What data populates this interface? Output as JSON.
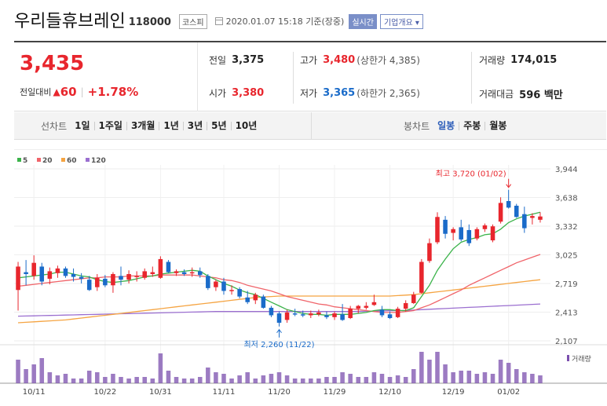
{
  "header": {
    "company": "우리들휴브레인",
    "code": "118000",
    "market": "코스피",
    "datetime": "2020.01.07 15:18 기준(장중)",
    "realtime_btn": "실시간",
    "overview_btn": "기업개요 ▾"
  },
  "quote": {
    "price": "3,435",
    "change_label": "전일대비",
    "change_arrow": "▲",
    "change_value": "60",
    "change_pct": "+1.78%",
    "prev_close": {
      "label": "전일",
      "value": "3,375"
    },
    "open": {
      "label": "시가",
      "value": "3,380"
    },
    "high": {
      "label": "고가",
      "value": "3,480",
      "sub": "(상한가 4,385)"
    },
    "low": {
      "label": "저가",
      "value": "3,365",
      "sub": "(하한가 2,365)"
    },
    "volume": {
      "label": "거래량",
      "value": "174,015"
    },
    "amount": {
      "label": "거래대금",
      "value": "596 백만"
    }
  },
  "periods": {
    "chart_label": "선차트",
    "chart_options": [
      "1일",
      "1주일",
      "3개월",
      "1년",
      "3년",
      "5년",
      "10년"
    ],
    "candle_label": "봉차트",
    "candle_options": [
      "일봉",
      "주봉",
      "월봉"
    ],
    "candle_selected": 0
  },
  "colors": {
    "up": "#e8262d",
    "down": "#1a6bc9",
    "ma5": "#3bb34a",
    "ma20": "#f0646a",
    "ma60": "#f5a442",
    "ma120": "#9b6fd0",
    "volume": "#7b4fae"
  },
  "chart_data": {
    "type": "candlestick",
    "legend": [
      "5",
      "20",
      "60",
      "120"
    ],
    "y_ticks": [
      "3,944",
      "3,638",
      "3,332",
      "3,025",
      "2,719",
      "2,413",
      "2,107"
    ],
    "ylim": [
      2107,
      3944
    ],
    "x_labels": [
      {
        "i": 2,
        "label": "10/11"
      },
      {
        "i": 11,
        "label": "10/22"
      },
      {
        "i": 18,
        "label": "10/31"
      },
      {
        "i": 26,
        "label": "11/11"
      },
      {
        "i": 33,
        "label": "11/20"
      },
      {
        "i": 40,
        "label": "11/29"
      },
      {
        "i": 47,
        "label": "12/10"
      },
      {
        "i": 55,
        "label": "12/19"
      },
      {
        "i": 62,
        "label": "01/02"
      }
    ],
    "annotations": {
      "high_label": "최고 3,720 (01/02)",
      "low_label": "최저 2,260 (11/22)",
      "volume_label": "거래량"
    },
    "candles": [
      {
        "o": 2650,
        "h": 2950,
        "l": 2430,
        "c": 2900,
        "v": 0.75
      },
      {
        "o": 2840,
        "h": 2970,
        "l": 2700,
        "c": 2820,
        "v": 0.45
      },
      {
        "o": 2800,
        "h": 3020,
        "l": 2760,
        "c": 2940,
        "v": 0.6
      },
      {
        "o": 2900,
        "h": 2940,
        "l": 2700,
        "c": 2740,
        "v": 0.8
      },
      {
        "o": 2770,
        "h": 2890,
        "l": 2710,
        "c": 2850,
        "v": 0.35
      },
      {
        "o": 2830,
        "h": 2910,
        "l": 2780,
        "c": 2880,
        "v": 0.25
      },
      {
        "o": 2880,
        "h": 2900,
        "l": 2780,
        "c": 2800,
        "v": 0.3
      },
      {
        "o": 2820,
        "h": 2880,
        "l": 2740,
        "c": 2790,
        "v": 0.15
      },
      {
        "o": 2790,
        "h": 2830,
        "l": 2720,
        "c": 2770,
        "v": 0.15
      },
      {
        "o": 2760,
        "h": 2800,
        "l": 2640,
        "c": 2650,
        "v": 0.4
      },
      {
        "o": 2680,
        "h": 2820,
        "l": 2640,
        "c": 2780,
        "v": 0.35
      },
      {
        "o": 2770,
        "h": 2810,
        "l": 2680,
        "c": 2700,
        "v": 0.2
      },
      {
        "o": 2700,
        "h": 2840,
        "l": 2620,
        "c": 2820,
        "v": 0.3
      },
      {
        "o": 2800,
        "h": 2900,
        "l": 2700,
        "c": 2760,
        "v": 0.2
      },
      {
        "o": 2760,
        "h": 2860,
        "l": 2720,
        "c": 2820,
        "v": 0.15
      },
      {
        "o": 2790,
        "h": 2850,
        "l": 2740,
        "c": 2800,
        "v": 0.2
      },
      {
        "o": 2780,
        "h": 2880,
        "l": 2760,
        "c": 2850,
        "v": 0.2
      },
      {
        "o": 2820,
        "h": 2900,
        "l": 2790,
        "c": 2840,
        "v": 0.15
      },
      {
        "o": 2780,
        "h": 3010,
        "l": 2770,
        "c": 2980,
        "v": 0.95
      },
      {
        "o": 2950,
        "h": 2970,
        "l": 2830,
        "c": 2840,
        "v": 0.4
      },
      {
        "o": 2830,
        "h": 2870,
        "l": 2800,
        "c": 2850,
        "v": 0.2
      },
      {
        "o": 2840,
        "h": 2870,
        "l": 2800,
        "c": 2820,
        "v": 0.15
      },
      {
        "o": 2830,
        "h": 2890,
        "l": 2790,
        "c": 2840,
        "v": 0.15
      },
      {
        "o": 2850,
        "h": 2890,
        "l": 2780,
        "c": 2810,
        "v": 0.2
      },
      {
        "o": 2800,
        "h": 2820,
        "l": 2650,
        "c": 2670,
        "v": 0.5
      },
      {
        "o": 2680,
        "h": 2760,
        "l": 2640,
        "c": 2740,
        "v": 0.35
      },
      {
        "o": 2740,
        "h": 2780,
        "l": 2600,
        "c": 2640,
        "v": 0.3
      },
      {
        "o": 2640,
        "h": 2700,
        "l": 2600,
        "c": 2650,
        "v": 0.15
      },
      {
        "o": 2660,
        "h": 2680,
        "l": 2560,
        "c": 2580,
        "v": 0.25
      },
      {
        "o": 2570,
        "h": 2640,
        "l": 2500,
        "c": 2520,
        "v": 0.35
      },
      {
        "o": 2540,
        "h": 2620,
        "l": 2500,
        "c": 2600,
        "v": 0.15
      },
      {
        "o": 2580,
        "h": 2600,
        "l": 2450,
        "c": 2460,
        "v": 0.25
      },
      {
        "o": 2460,
        "h": 2480,
        "l": 2360,
        "c": 2380,
        "v": 0.3
      },
      {
        "o": 2400,
        "h": 2420,
        "l": 2260,
        "c": 2300,
        "v": 0.35
      },
      {
        "o": 2330,
        "h": 2440,
        "l": 2300,
        "c": 2410,
        "v": 0.25
      },
      {
        "o": 2400,
        "h": 2450,
        "l": 2370,
        "c": 2390,
        "v": 0.15
      },
      {
        "o": 2390,
        "h": 2430,
        "l": 2360,
        "c": 2380,
        "v": 0.15
      },
      {
        "o": 2380,
        "h": 2430,
        "l": 2350,
        "c": 2400,
        "v": 0.15
      },
      {
        "o": 2390,
        "h": 2440,
        "l": 2370,
        "c": 2410,
        "v": 0.15
      },
      {
        "o": 2380,
        "h": 2420,
        "l": 2340,
        "c": 2360,
        "v": 0.2
      },
      {
        "o": 2360,
        "h": 2420,
        "l": 2330,
        "c": 2400,
        "v": 0.2
      },
      {
        "o": 2390,
        "h": 2500,
        "l": 2320,
        "c": 2330,
        "v": 0.35
      },
      {
        "o": 2350,
        "h": 2480,
        "l": 2340,
        "c": 2450,
        "v": 0.3
      },
      {
        "o": 2450,
        "h": 2490,
        "l": 2400,
        "c": 2480,
        "v": 0.2
      },
      {
        "o": 2460,
        "h": 2520,
        "l": 2440,
        "c": 2480,
        "v": 0.2
      },
      {
        "o": 2490,
        "h": 2600,
        "l": 2480,
        "c": 2520,
        "v": 0.35
      },
      {
        "o": 2440,
        "h": 2480,
        "l": 2360,
        "c": 2380,
        "v": 0.3
      },
      {
        "o": 2390,
        "h": 2420,
        "l": 2340,
        "c": 2350,
        "v": 0.2
      },
      {
        "o": 2360,
        "h": 2470,
        "l": 2350,
        "c": 2450,
        "v": 0.25
      },
      {
        "o": 2450,
        "h": 2540,
        "l": 2420,
        "c": 2510,
        "v": 0.2
      },
      {
        "o": 2510,
        "h": 2630,
        "l": 2500,
        "c": 2600,
        "v": 0.45
      },
      {
        "o": 2620,
        "h": 2980,
        "l": 2610,
        "c": 2950,
        "v": 1.0
      },
      {
        "o": 2960,
        "h": 3200,
        "l": 2940,
        "c": 3150,
        "v": 0.75
      },
      {
        "o": 3160,
        "h": 3480,
        "l": 3140,
        "c": 3430,
        "v": 1.0
      },
      {
        "o": 3400,
        "h": 3440,
        "l": 3200,
        "c": 3250,
        "v": 0.6
      },
      {
        "o": 3260,
        "h": 3320,
        "l": 3180,
        "c": 3300,
        "v": 0.35
      },
      {
        "o": 3320,
        "h": 3400,
        "l": 3170,
        "c": 3190,
        "v": 0.4
      },
      {
        "o": 3290,
        "h": 3350,
        "l": 3120,
        "c": 3150,
        "v": 0.4
      },
      {
        "o": 3200,
        "h": 3320,
        "l": 3180,
        "c": 3300,
        "v": 0.3
      },
      {
        "o": 3300,
        "h": 3360,
        "l": 3270,
        "c": 3340,
        "v": 0.35
      },
      {
        "o": 3180,
        "h": 3350,
        "l": 3160,
        "c": 3330,
        "v": 0.3
      },
      {
        "o": 3380,
        "h": 3640,
        "l": 3360,
        "c": 3580,
        "v": 0.75
      },
      {
        "o": 3600,
        "h": 3720,
        "l": 3520,
        "c": 3530,
        "v": 0.65
      },
      {
        "o": 3550,
        "h": 3570,
        "l": 3420,
        "c": 3430,
        "v": 0.45
      },
      {
        "o": 3460,
        "h": 3540,
        "l": 3260,
        "c": 3310,
        "v": 0.35
      },
      {
        "o": 3420,
        "h": 3470,
        "l": 3350,
        "c": 3440,
        "v": 0.3
      },
      {
        "o": 3400,
        "h": 3480,
        "l": 3370,
        "c": 3435,
        "v": 0.25
      }
    ],
    "ma5": [
      2780,
      2790,
      2800,
      2810,
      2820,
      2840,
      2840,
      2820,
      2800,
      2790,
      2760,
      2740,
      2730,
      2740,
      2750,
      2770,
      2790,
      2800,
      2820,
      2830,
      2840,
      2850,
      2860,
      2850,
      2800,
      2760,
      2720,
      2690,
      2650,
      2620,
      2600,
      2560,
      2520,
      2480,
      2440,
      2420,
      2400,
      2390,
      2390,
      2380,
      2390,
      2390,
      2390,
      2400,
      2410,
      2430,
      2440,
      2440,
      2430,
      2430,
      2460,
      2580,
      2700,
      2860,
      2980,
      3090,
      3160,
      3190,
      3210,
      3240,
      3250,
      3300,
      3370,
      3410,
      3440,
      3460,
      3480
    ],
    "ma20": [
      2690,
      2700,
      2710,
      2720,
      2730,
      2740,
      2750,
      2760,
      2770,
      2780,
      2780,
      2790,
      2790,
      2790,
      2800,
      2800,
      2800,
      2800,
      2810,
      2810,
      2810,
      2810,
      2810,
      2800,
      2790,
      2780,
      2760,
      2750,
      2730,
      2700,
      2680,
      2660,
      2640,
      2610,
      2580,
      2560,
      2540,
      2520,
      2500,
      2490,
      2470,
      2460,
      2450,
      2440,
      2430,
      2420,
      2410,
      2410,
      2410,
      2420,
      2430,
      2460,
      2490,
      2530,
      2570,
      2610,
      2650,
      2700,
      2740,
      2780,
      2820,
      2860,
      2900,
      2940,
      2970,
      3000,
      3030
    ],
    "ma60": [
      2300,
      2305,
      2310,
      2315,
      2320,
      2325,
      2330,
      2340,
      2350,
      2360,
      2370,
      2380,
      2390,
      2400,
      2410,
      2420,
      2430,
      2440,
      2450,
      2460,
      2470,
      2480,
      2490,
      2500,
      2510,
      2520,
      2530,
      2540,
      2550,
      2560,
      2570,
      2575,
      2580,
      2585,
      2585,
      2585,
      2585,
      2585,
      2585,
      2585,
      2585,
      2585,
      2585,
      2585,
      2585,
      2585,
      2585,
      2585,
      2590,
      2595,
      2600,
      2610,
      2620,
      2630,
      2640,
      2650,
      2660,
      2670,
      2680,
      2690,
      2700,
      2710,
      2720,
      2730,
      2740,
      2750,
      2760
    ],
    "ma120": [
      2370,
      2372,
      2374,
      2376,
      2378,
      2380,
      2382,
      2384,
      2386,
      2388,
      2390,
      2392,
      2394,
      2396,
      2398,
      2400,
      2402,
      2404,
      2406,
      2408,
      2410,
      2412,
      2414,
      2416,
      2418,
      2420,
      2420,
      2420,
      2420,
      2420,
      2420,
      2420,
      2420,
      2420,
      2420,
      2420,
      2420,
      2420,
      2420,
      2420,
      2420,
      2420,
      2420,
      2420,
      2422,
      2424,
      2426,
      2428,
      2430,
      2432,
      2436,
      2440,
      2444,
      2448,
      2452,
      2456,
      2460,
      2464,
      2468,
      2472,
      2476,
      2480,
      2484,
      2488,
      2492,
      2496,
      2500
    ]
  }
}
